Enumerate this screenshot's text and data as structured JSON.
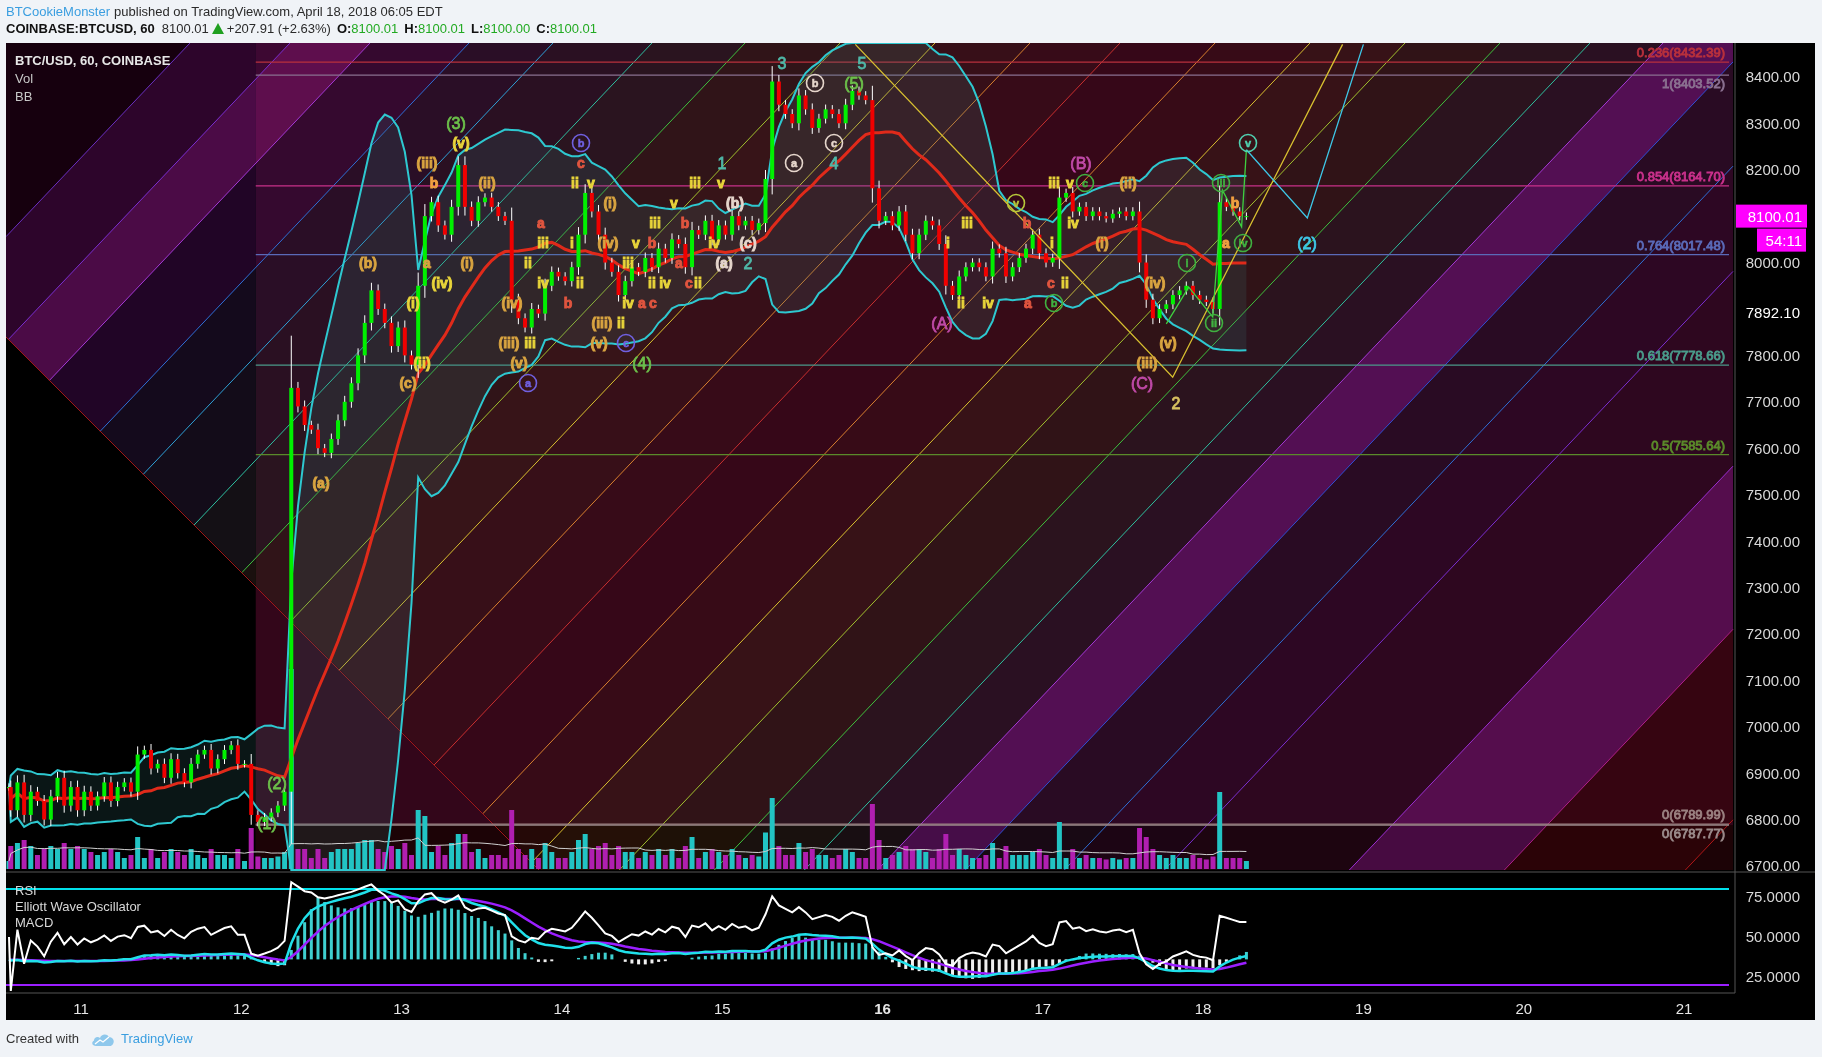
{
  "header": {
    "author": "BTCookieMonster",
    "published": "published on TradingView.com, April 18, 2018 06:05 EDT"
  },
  "ticker": {
    "symbol": "COINBASE:BTCUSD, 60",
    "price": "8100.01",
    "rising": true,
    "change": "+207.91 (+2.63%)",
    "ohlc": [
      {
        "label": "O:",
        "value": "8100.01"
      },
      {
        "label": "H:",
        "value": "8100.01"
      },
      {
        "label": "L:",
        "value": "8100.00"
      },
      {
        "label": "C:",
        "value": "8100.01"
      }
    ]
  },
  "chart": {
    "legend": {
      "title": "BTC/USD, 60, COINBASE",
      "items": [
        "Vol",
        "BB"
      ]
    },
    "wave_labels": [
      {
        "text": "3",
        "color": "#4fb8a8",
        "kind": "major"
      },
      {
        "text": "5",
        "color": "#4fb8a8",
        "kind": "major"
      },
      {
        "text": "b",
        "color": "#e6d6cc",
        "kind": "circled"
      },
      {
        "text": "(5)",
        "color": "#6cc04a",
        "kind": "major"
      },
      {
        "text": "(3)",
        "color": "#6cc04a",
        "kind": "major"
      },
      {
        "text": "(v)",
        "color": "#e8d43a",
        "kind": "minor"
      },
      {
        "text": "b",
        "color": "#7060e0",
        "kind": "circled"
      },
      {
        "text": "c",
        "color": "#e6d6cc",
        "kind": "circled"
      },
      {
        "text": "v",
        "color": "#50d0b0",
        "kind": "circled"
      },
      {
        "text": "(iii)",
        "color": "#d9a440",
        "kind": "minor"
      },
      {
        "text": "c",
        "color": "#e0553f",
        "kind": "minor"
      },
      {
        "text": "1",
        "color": "#4fb8a8",
        "kind": "major"
      },
      {
        "text": "a",
        "color": "#e6d6cc",
        "kind": "circled"
      },
      {
        "text": "4",
        "color": "#4fb8a8",
        "kind": "major"
      },
      {
        "text": "(B)",
        "color": "#c04aa8",
        "kind": "major"
      },
      {
        "text": "b",
        "color": "#f0a040",
        "kind": "minor"
      },
      {
        "text": "(ii)",
        "color": "#d9a440",
        "kind": "minor"
      },
      {
        "text": "ii",
        "color": "#e8d43a",
        "kind": "minor"
      },
      {
        "text": "v",
        "color": "#e8d43a",
        "kind": "minor"
      },
      {
        "text": "iii",
        "color": "#e8d43a",
        "kind": "minor"
      },
      {
        "text": "v",
        "color": "#e8d43a",
        "kind": "minor"
      },
      {
        "text": "iii",
        "color": "#e8d43a",
        "kind": "minor"
      },
      {
        "text": "v",
        "color": "#e8d43a",
        "kind": "minor"
      },
      {
        "text": "c",
        "color": "#40b040",
        "kind": "circled"
      },
      {
        "text": "(ii)",
        "color": "#d9a440",
        "kind": "minor"
      },
      {
        "text": "iii",
        "color": "#40b040",
        "kind": "circled"
      },
      {
        "text": "(i)",
        "color": "#d9a440",
        "kind": "minor"
      },
      {
        "text": "v",
        "color": "#e8d43a",
        "kind": "minor"
      },
      {
        "text": "(b)",
        "color": "#e6d6cc",
        "kind": "minor"
      },
      {
        "text": "v",
        "color": "#b8c83a",
        "kind": "circled"
      },
      {
        "text": "b",
        "color": "#f0a040",
        "kind": "minor"
      },
      {
        "text": "a",
        "color": "#e0553f",
        "kind": "minor"
      },
      {
        "text": "iii",
        "color": "#e8d43a",
        "kind": "minor"
      },
      {
        "text": "b",
        "color": "#e0553f",
        "kind": "minor"
      },
      {
        "text": "iii",
        "color": "#e8d43a",
        "kind": "minor"
      },
      {
        "text": "b",
        "color": "#e0553f",
        "kind": "minor"
      },
      {
        "text": "iv",
        "color": "#e8d43a",
        "kind": "minor"
      },
      {
        "text": "iii",
        "color": "#e8d43a",
        "kind": "minor"
      },
      {
        "text": "i",
        "color": "#e8d43a",
        "kind": "minor"
      },
      {
        "text": "(iv)",
        "color": "#d9a440",
        "kind": "minor"
      },
      {
        "text": "v",
        "color": "#e8d43a",
        "kind": "minor"
      },
      {
        "text": "b",
        "color": "#e0553f",
        "kind": "minor"
      },
      {
        "text": "iv",
        "color": "#e8d43a",
        "kind": "minor"
      },
      {
        "text": "(c)",
        "color": "#e6d6cc",
        "kind": "minor"
      },
      {
        "text": "i",
        "color": "#e8d43a",
        "kind": "minor"
      },
      {
        "text": "i",
        "color": "#e8d43a",
        "kind": "minor"
      },
      {
        "text": "(i)",
        "color": "#d9a440",
        "kind": "minor"
      },
      {
        "text": "a",
        "color": "#f0a040",
        "kind": "minor"
      },
      {
        "text": "iv",
        "color": "#40b040",
        "kind": "circled"
      },
      {
        "text": "(2)",
        "color": "#3ec8e8",
        "kind": "major"
      },
      {
        "text": "(b)",
        "color": "#d9a440",
        "kind": "minor"
      },
      {
        "text": "a",
        "color": "#d9a440",
        "kind": "minor"
      },
      {
        "text": "(i)",
        "color": "#d9a440",
        "kind": "minor"
      },
      {
        "text": "ii",
        "color": "#e8d43a",
        "kind": "minor"
      },
      {
        "text": "iii",
        "color": "#e8d43a",
        "kind": "minor"
      },
      {
        "text": "a",
        "color": "#e0553f",
        "kind": "minor"
      },
      {
        "text": "(a)",
        "color": "#e6d6cc",
        "kind": "minor"
      },
      {
        "text": "2",
        "color": "#4fb8a8",
        "kind": "major"
      },
      {
        "text": "i",
        "color": "#40b040",
        "kind": "circled"
      },
      {
        "text": "(iv)",
        "color": "#e8d43a",
        "kind": "minor"
      },
      {
        "text": "iv",
        "color": "#e8d43a",
        "kind": "minor"
      },
      {
        "text": "ii",
        "color": "#e8d43a",
        "kind": "minor"
      },
      {
        "text": "ii",
        "color": "#e8d43a",
        "kind": "minor"
      },
      {
        "text": "iv",
        "color": "#e8d43a",
        "kind": "minor"
      },
      {
        "text": "c",
        "color": "#e0553f",
        "kind": "minor"
      },
      {
        "text": "ii",
        "color": "#e8d43a",
        "kind": "minor"
      },
      {
        "text": "c",
        "color": "#e0553f",
        "kind": "minor"
      },
      {
        "text": "ii",
        "color": "#e8d43a",
        "kind": "minor"
      },
      {
        "text": "(iv)",
        "color": "#d9a440",
        "kind": "minor"
      },
      {
        "text": "(i)",
        "color": "#e8d43a",
        "kind": "minor"
      },
      {
        "text": "(iv)",
        "color": "#d9a440",
        "kind": "minor"
      },
      {
        "text": "b",
        "color": "#e0553f",
        "kind": "minor"
      },
      {
        "text": "iv",
        "color": "#e8d43a",
        "kind": "minor"
      },
      {
        "text": "a",
        "color": "#e0553f",
        "kind": "minor"
      },
      {
        "text": "c",
        "color": "#e0553f",
        "kind": "minor"
      },
      {
        "text": "ii",
        "color": "#e8d43a",
        "kind": "minor"
      },
      {
        "text": "iv",
        "color": "#e8d43a",
        "kind": "minor"
      },
      {
        "text": "a",
        "color": "#e0553f",
        "kind": "minor"
      },
      {
        "text": "b",
        "color": "#40b040",
        "kind": "circled"
      },
      {
        "text": "(iii)",
        "color": "#d9a440",
        "kind": "minor"
      },
      {
        "text": "ii",
        "color": "#e8d43a",
        "kind": "minor"
      },
      {
        "text": "(A)",
        "color": "#c04aa8",
        "kind": "major"
      },
      {
        "text": "ii",
        "color": "#40b040",
        "kind": "circled"
      },
      {
        "text": "(iii)",
        "color": "#d9a440",
        "kind": "minor"
      },
      {
        "text": "iii",
        "color": "#e8d43a",
        "kind": "minor"
      },
      {
        "text": "(v)",
        "color": "#d9a440",
        "kind": "minor"
      },
      {
        "text": "c",
        "color": "#7060e0",
        "kind": "circled"
      },
      {
        "text": "(v)",
        "color": "#d9a440",
        "kind": "minor"
      },
      {
        "text": "(ii)",
        "color": "#e8d43a",
        "kind": "minor"
      },
      {
        "text": "(v)",
        "color": "#d9a440",
        "kind": "minor"
      },
      {
        "text": "(4)",
        "color": "#6cc04a",
        "kind": "major"
      },
      {
        "text": "(iii)",
        "color": "#d9a440",
        "kind": "minor"
      },
      {
        "text": "(c)",
        "color": "#d9a440",
        "kind": "minor"
      },
      {
        "text": "a",
        "color": "#7060e0",
        "kind": "circled"
      },
      {
        "text": "(C)",
        "color": "#c04aa8",
        "kind": "major"
      },
      {
        "text": "2",
        "color": "#d8c060",
        "kind": "major"
      },
      {
        "text": "(a)",
        "color": "#d9a440",
        "kind": "minor"
      },
      {
        "text": "(2)",
        "color": "#6cc04a",
        "kind": "major"
      },
      {
        "text": "(1)",
        "color": "#6cc04a",
        "kind": "major"
      }
    ],
    "fib_levels": [
      {
        "label": "0.236(8432.39)",
        "color": "#b8303c"
      },
      {
        "label": "1(8403.52)",
        "color": "#8a7090"
      },
      {
        "label": "0.854(8164.70)",
        "color": "#c8308a"
      },
      {
        "label": "0.764(8017.48)",
        "color": "#5a6ab8"
      },
      {
        "label": "0.618(7778.66)",
        "color": "#4a9a8a"
      },
      {
        "label": "0.5(7585.64)",
        "color": "#5a8a2a"
      },
      {
        "label": "0(6789.99)",
        "color": "#9a8080"
      },
      {
        "label": "0(6787.77)",
        "color": "#9a8a8a"
      }
    ],
    "price_axis": [
      "8400.00",
      "8300.00",
      "8200.00",
      "8000.00",
      "7800.00",
      "7700.00",
      "7600.00",
      "7500.00",
      "7400.00",
      "7300.00",
      "7200.00",
      "7100.00",
      "7000.00",
      "6900.00",
      "6800.00",
      "6700.00"
    ],
    "price_markers": [
      {
        "kind": "last",
        "label": "8100.01",
        "color": "#ff00ff"
      },
      {
        "kind": "countdown",
        "label": "54:11",
        "color": "#ff00ff"
      },
      {
        "kind": "level",
        "label": "7892.10"
      }
    ],
    "time_axis": [
      {
        "label": "11",
        "bold": false
      },
      {
        "label": "12",
        "bold": false
      },
      {
        "label": "13",
        "bold": false
      },
      {
        "label": "14",
        "bold": false
      },
      {
        "label": "15",
        "bold": false
      },
      {
        "label": "16",
        "bold": true
      },
      {
        "label": "17",
        "bold": false
      },
      {
        "label": "18",
        "bold": false
      },
      {
        "label": "19",
        "bold": false
      },
      {
        "label": "20",
        "bold": false
      },
      {
        "label": "21",
        "bold": false
      }
    ],
    "oscillators": {
      "legend": [
        "RSI",
        "Elliott Wave Oscillator",
        "MACD"
      ],
      "axis": [
        "75.0000",
        "50.0000",
        "25.0000"
      ]
    }
  },
  "footer": {
    "text": "Created with",
    "brand": "TradingView"
  }
}
